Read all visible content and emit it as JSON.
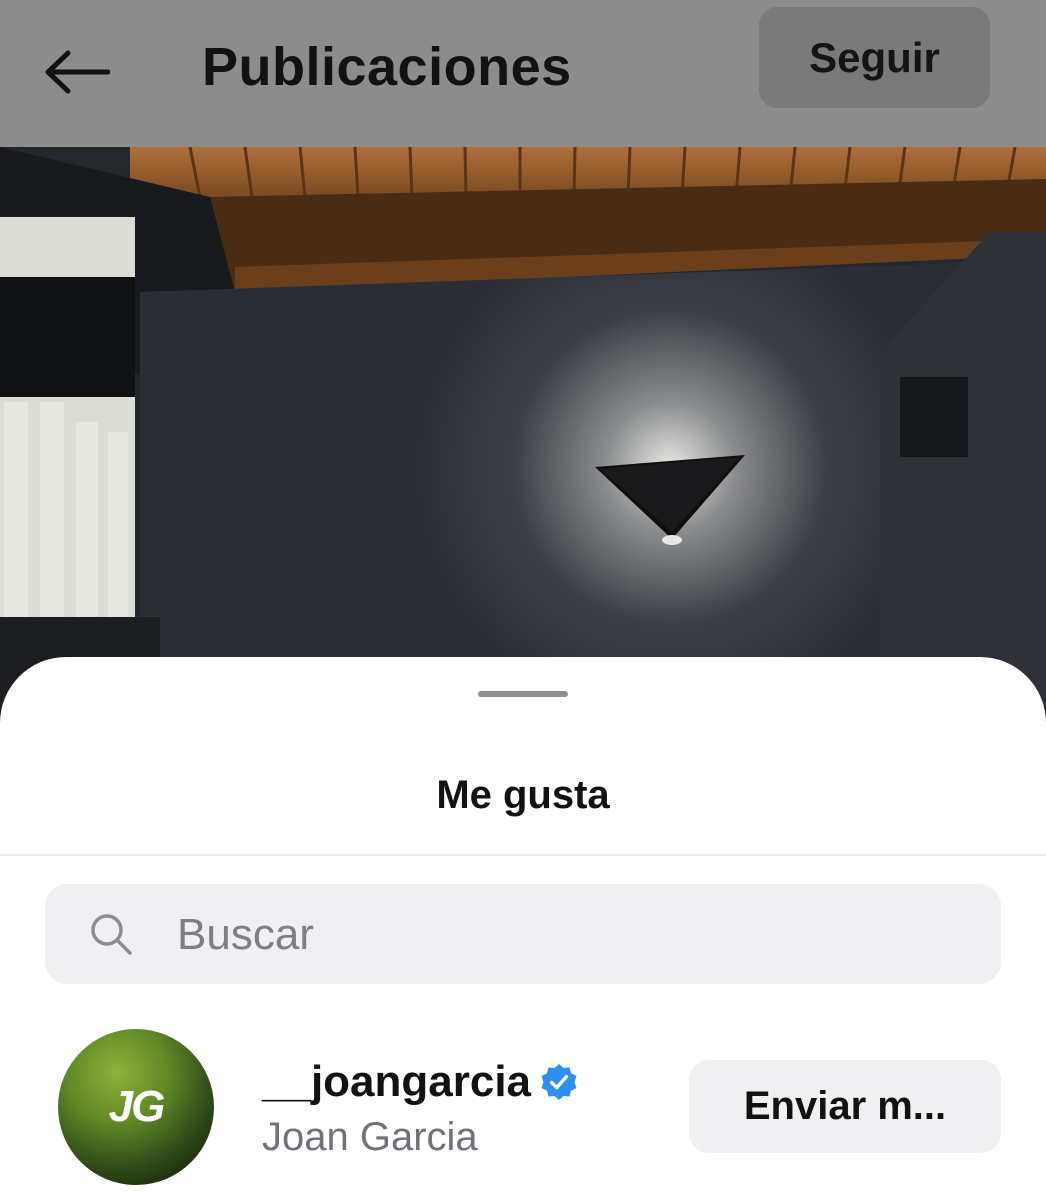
{
  "header": {
    "back_icon": "arrow-left-icon",
    "title": "Publicaciones",
    "follow_label": "Seguir"
  },
  "post": {
    "description_icon": "photo-of-room-with-wall-lamp"
  },
  "likes_sheet": {
    "title": "Me gusta",
    "search": {
      "icon": "search-icon",
      "placeholder": "Buscar",
      "value": ""
    },
    "users": [
      {
        "username": "__joangarcia",
        "verified": true,
        "full_name": "Joan Garcia",
        "avatar_initials": "JG",
        "action_label": "Enviar m..."
      }
    ]
  },
  "colors": {
    "verified_blue": "#2e8ff0",
    "header_overlay": "#8c8c8c"
  }
}
